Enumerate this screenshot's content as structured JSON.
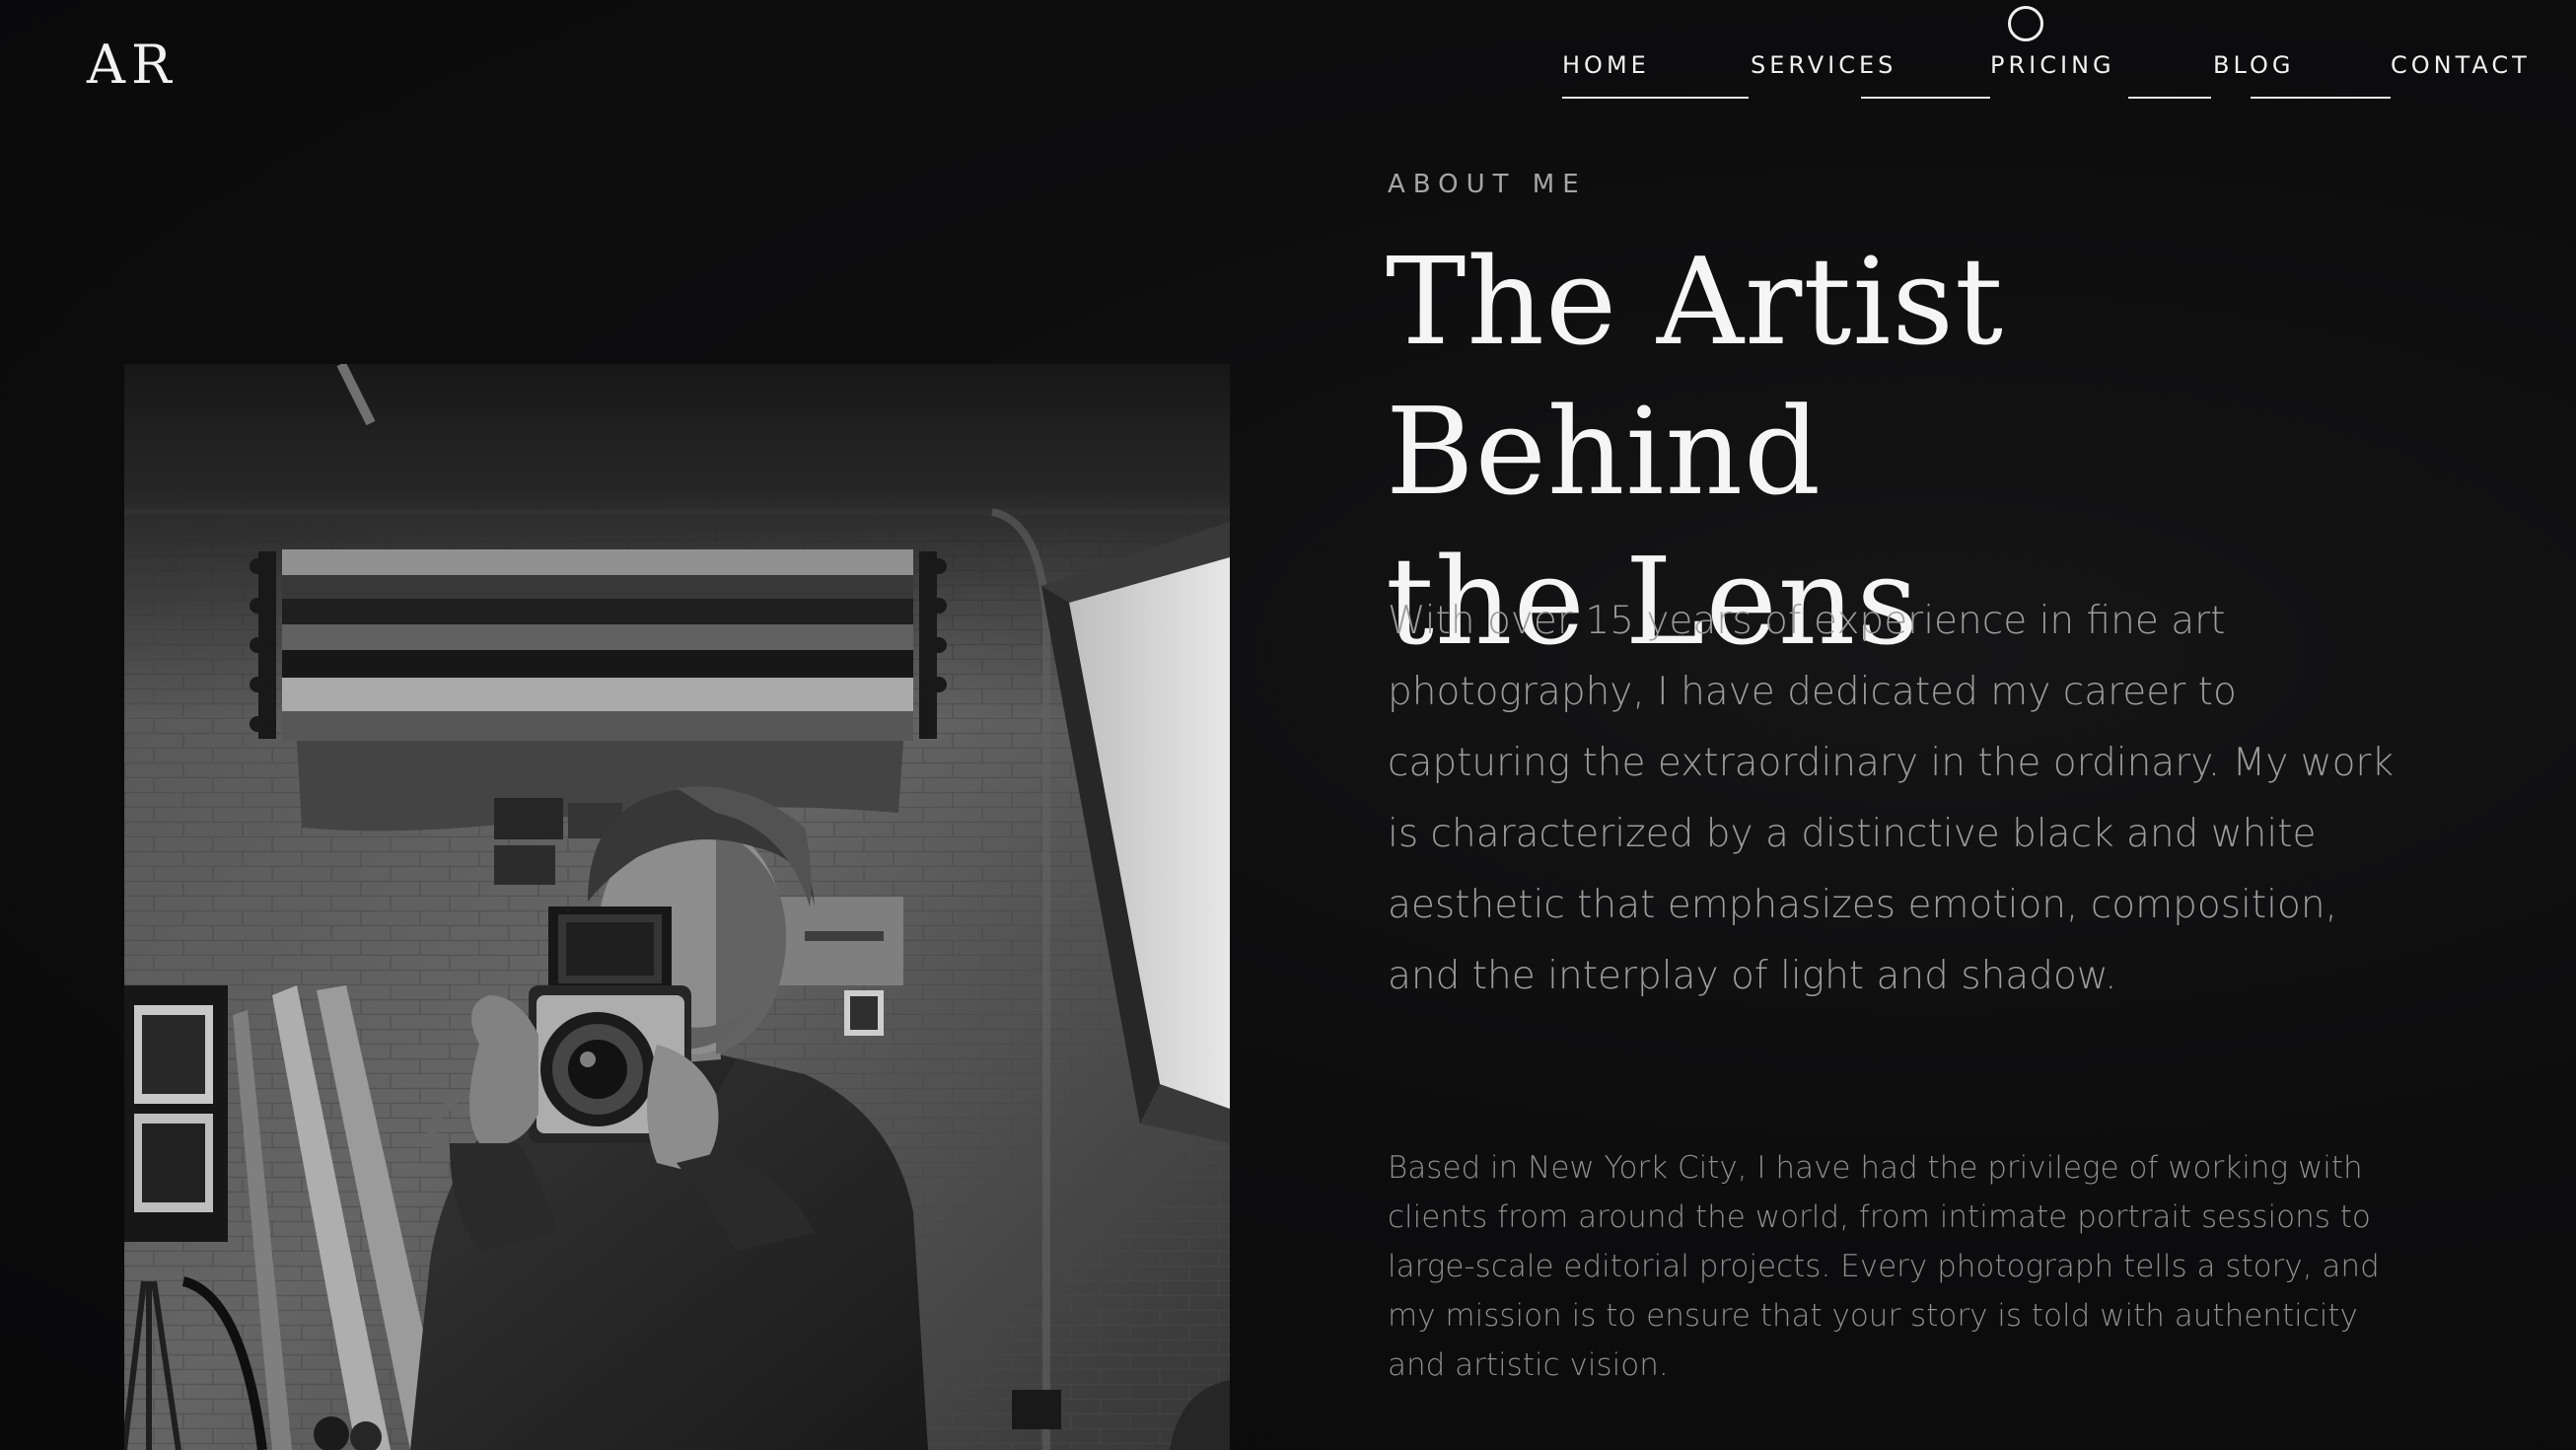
{
  "brand": {
    "logo": "AR"
  },
  "nav": {
    "items": [
      {
        "label": "HOME"
      },
      {
        "label": "SERVICES"
      },
      {
        "label": "PRICING"
      },
      {
        "label": "BLOG"
      },
      {
        "label": "CONTACT"
      }
    ]
  },
  "about": {
    "eyebrow": "ABOUT ME",
    "title_line1": "The Artist Behind",
    "title_line2": "the Lens",
    "lead": "With over 15 years of experience in fine art photography, I have dedicated my career to capturing the extraordinary in the ordinary. My work is characterized by a distinctive black and white aesthetic that emphasizes emotion, composition, and the interplay of light and shadow.",
    "body": "Based in New York City, I have had the privilege of working with clients from around the world, from intimate portrait sessions to large-scale editorial projects. Every photograph tells a story, and my mission is to ensure that your story is told with authenticity and artistic vision."
  },
  "colors": {
    "background": "#0b0b0c",
    "text_primary": "#f5f5f5",
    "text_muted": "#9c9c9c"
  }
}
